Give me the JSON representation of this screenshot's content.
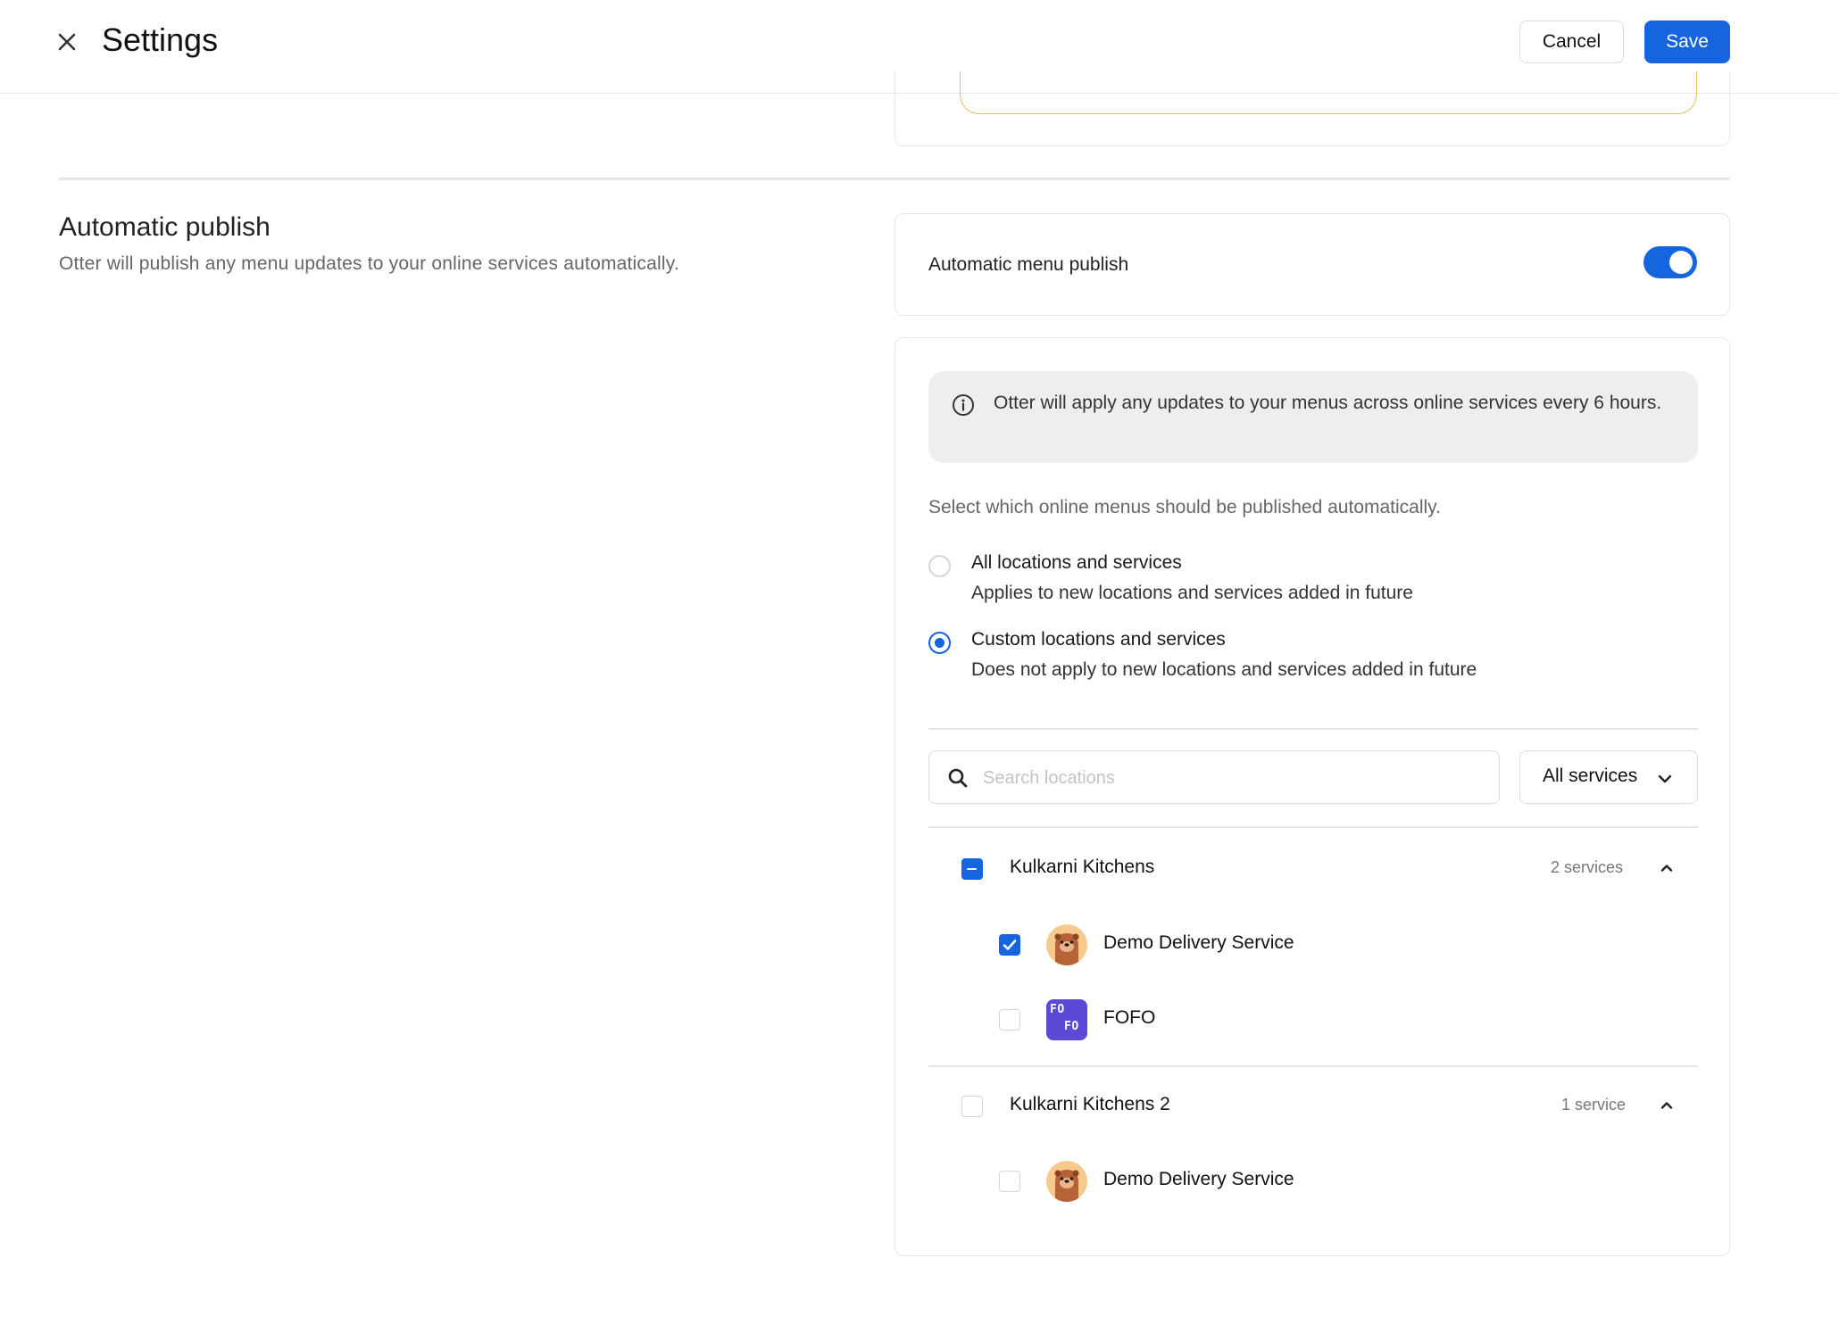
{
  "header": {
    "title": "Settings",
    "cancel_label": "Cancel",
    "save_label": "Save"
  },
  "section": {
    "title": "Automatic publish",
    "description": "Otter will publish any menu updates to your online services automatically."
  },
  "toggle": {
    "label": "Automatic menu publish",
    "enabled": true
  },
  "info_banner": {
    "text": "Otter will apply any updates to your menus across online services every 6 hours."
  },
  "select_prompt": "Select which online menus should be published automatically.",
  "options": [
    {
      "title": "All locations and services",
      "subtitle": "Applies to new locations and services added in future",
      "selected": false
    },
    {
      "title": "Custom locations and services",
      "subtitle": "Does not apply to new locations and services added in future",
      "selected": true
    }
  ],
  "search": {
    "placeholder": "Search locations",
    "value": ""
  },
  "services_filter": {
    "label": "All services"
  },
  "locations": [
    {
      "name": "Kulkarni Kitchens",
      "count_label": "2 services",
      "state": "partial",
      "services": [
        {
          "name": "Demo Delivery Service",
          "icon": "otter-avatar-icon",
          "checked": true
        },
        {
          "name": "FOFO",
          "icon": "fofo-logo-icon",
          "logo_text": [
            "FO",
            "FO"
          ],
          "checked": false
        }
      ]
    },
    {
      "name": "Kulkarni Kitchens 2",
      "count_label": "1 service",
      "state": "unchecked",
      "services": [
        {
          "name": "Demo Delivery Service",
          "icon": "otter-avatar-icon",
          "checked": false
        }
      ]
    }
  ],
  "colors": {
    "accent": "#1565e0",
    "border": "#e6e6e6",
    "banner_bg": "#eeeeee",
    "fofo_bg": "#5b4ad6"
  }
}
